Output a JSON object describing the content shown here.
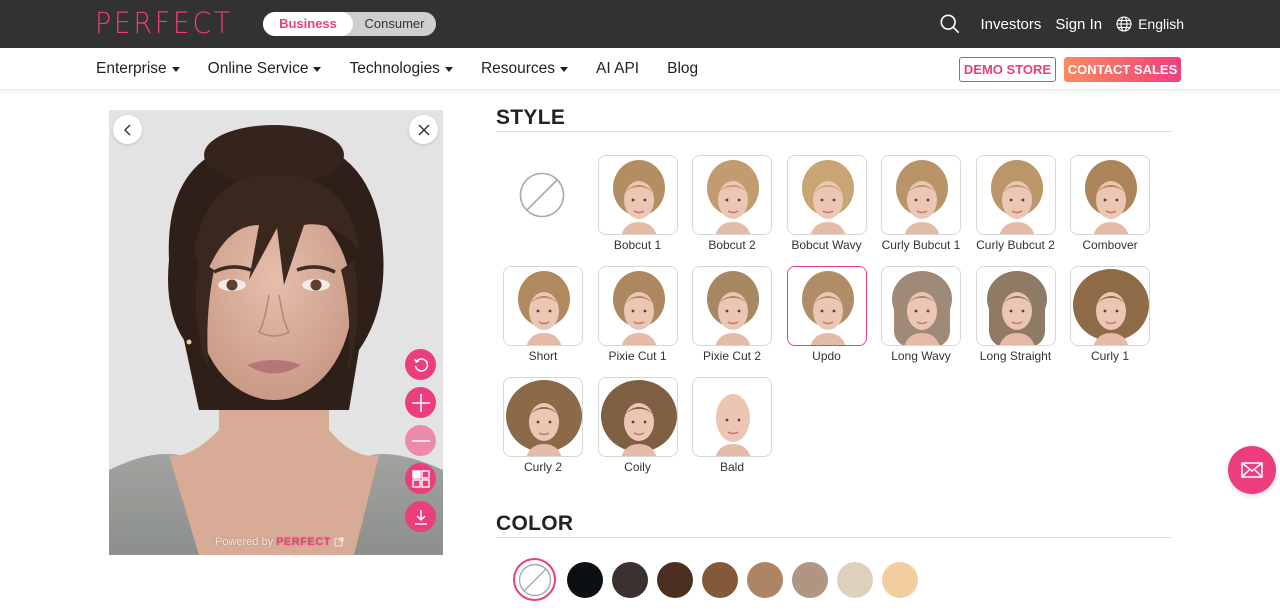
{
  "topbar": {
    "logo": "PERFECT",
    "audience_toggle": {
      "active": "Business",
      "inactive": "Consumer"
    },
    "links": {
      "investors": "Investors",
      "sign_in": "Sign In",
      "language": "English"
    },
    "icons": {
      "search": "search-icon",
      "language": "globe-icon"
    }
  },
  "nav": {
    "items": [
      {
        "label": "Enterprise",
        "dropdown": true
      },
      {
        "label": "Online Service",
        "dropdown": true
      },
      {
        "label": "Technologies",
        "dropdown": true
      },
      {
        "label": "Resources",
        "dropdown": true
      },
      {
        "label": "AI API",
        "dropdown": false
      },
      {
        "label": "Blog",
        "dropdown": false
      }
    ],
    "demo_store": "DEMO STORE",
    "contact_sales": "CONTACT SALES"
  },
  "photo_panel": {
    "controls": [
      "back-icon",
      "close-icon"
    ],
    "tools": [
      "reset-icon",
      "zoom-in-icon",
      "zoom-out-icon",
      "compare-grid-icon",
      "download-icon"
    ],
    "zoom_out_disabled": true,
    "powered_by": "Powered by",
    "powered_brand": "PERFECT"
  },
  "style": {
    "title": "STYLE",
    "selected": "Updo",
    "items": [
      {
        "label": "Bobcut 1",
        "hair": "#b48e63"
      },
      {
        "label": "Bobcut 2",
        "hair": "#c29c70"
      },
      {
        "label": "Bobcut Wavy",
        "hair": "#c9a574"
      },
      {
        "label": "Curly Bubcut 1",
        "hair": "#b99468"
      },
      {
        "label": "Curly Bubcut 2",
        "hair": "#bb966a"
      },
      {
        "label": "Combover",
        "hair": "#ab8459"
      },
      {
        "label": "Short",
        "hair": "#b08a5e"
      },
      {
        "label": "Pixie Cut 1",
        "hair": "#ad8760"
      },
      {
        "label": "Pixie Cut 2",
        "hair": "#a78862"
      },
      {
        "label": "Updo",
        "hair": "#b08d66"
      },
      {
        "label": "Long Wavy",
        "hair": "#9e8a76"
      },
      {
        "label": "Long Straight",
        "hair": "#8f7a66"
      },
      {
        "label": "Curly 1",
        "hair": "#8e6a47"
      },
      {
        "label": "Curly 2",
        "hair": "#8b6a4a"
      },
      {
        "label": "Coily",
        "hair": "#7e5f42"
      },
      {
        "label": "Bald",
        "hair": "#e9c9b2"
      }
    ]
  },
  "color": {
    "title": "COLOR",
    "selected": "none",
    "swatches": [
      "#0d1013",
      "#3b3230",
      "#4c2f20",
      "#84593a",
      "#ad8565",
      "#b09583",
      "#ddd1bd",
      "#f4cd9f"
    ]
  },
  "fab": {
    "icon": "mail-icon"
  }
}
